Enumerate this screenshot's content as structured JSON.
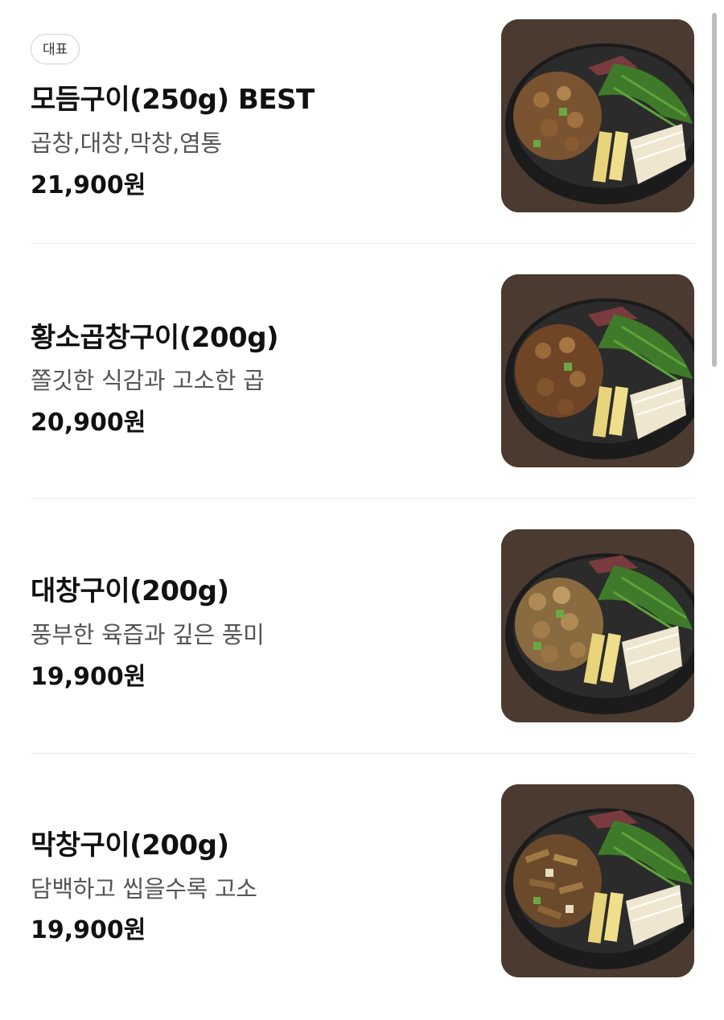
{
  "menu": {
    "items": [
      {
        "badge": "대표",
        "name": "모듬구이(250g) BEST",
        "description": "곱창,대창,막창,염통",
        "price": "21,900원",
        "image_icon": "food-photo-icon"
      },
      {
        "badge": "",
        "name": "황소곱창구이(200g)",
        "description": "쫄깃한 식감과 고소한 곱",
        "price": "20,900원",
        "image_icon": "food-photo-icon"
      },
      {
        "badge": "",
        "name": "대창구이(200g)",
        "description": "풍부한 육즙과 깊은 풍미",
        "price": "19,900원",
        "image_icon": "food-photo-icon"
      },
      {
        "badge": "",
        "name": "막창구이(200g)",
        "description": "담백하고 씹을수록 고소",
        "price": "19,900원",
        "image_icon": "food-photo-icon"
      }
    ]
  },
  "colors": {
    "background": "#ffffff",
    "text_primary": "#111111",
    "text_secondary": "#555555",
    "divider": "#ececec",
    "badge_border": "#cfcfcf",
    "scrollbar": "#bdbdbd"
  }
}
